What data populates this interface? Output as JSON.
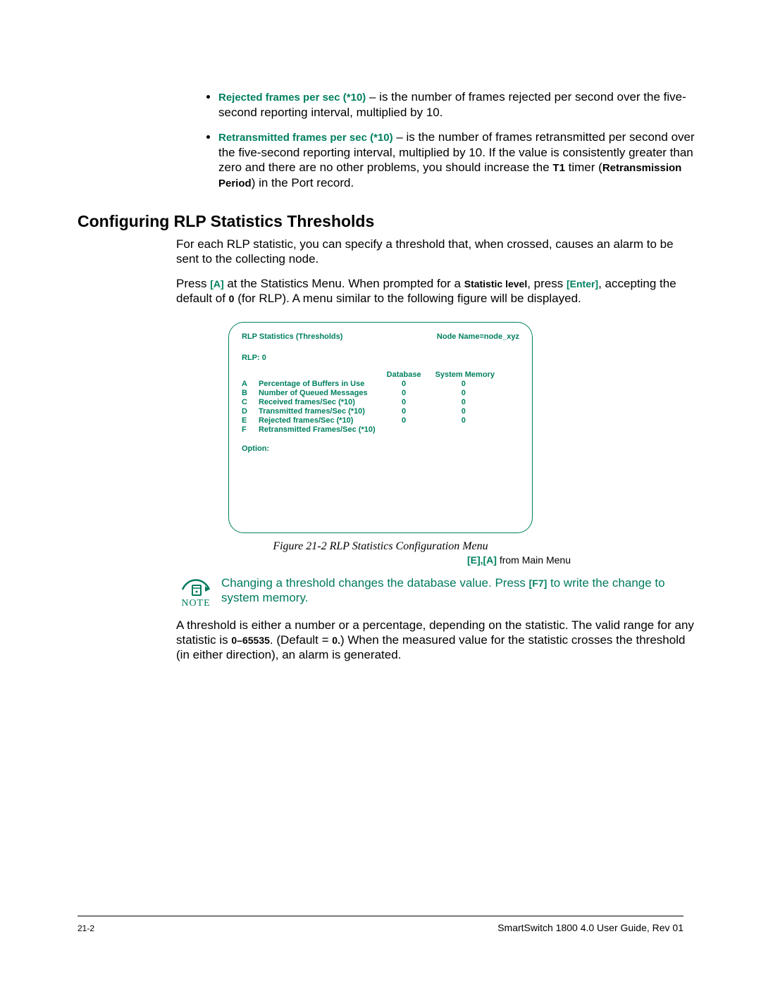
{
  "bullets": {
    "b1_term": "Rejected frames per sec (*10)",
    "b1_text": " – is the number of frames rejected per second over the five-second reporting interval, multiplied by 10.",
    "b2_term": "Retransmitted frames per sec (*10)",
    "b2_text_a": " – is the number of frames retransmitted per second over the five-second reporting interval, multiplied by 10. If the value is consistently greater than zero and there are no other problems, you should increase the ",
    "b2_t1": "T1",
    "b2_text_b": " timer (",
    "b2_retrans": "Retransmission Period",
    "b2_text_c": ") in the Port record."
  },
  "heading": "Configuring RLP Statistics Thresholds",
  "para1": "For each RLP statistic, you can specify a threshold that, when crossed, causes an alarm to be sent to the collecting node.",
  "para2": {
    "a": "Press ",
    "key_a": "[A]",
    "b": " at the Statistics Menu. When prompted for a ",
    "stat_lvl": "Statistic level",
    "c": ", press ",
    "key_enter": "[Enter]",
    "d": ", accepting the default of ",
    "zero": "0",
    "e": " (for RLP). A menu similar to the following figure will be displayed."
  },
  "figure": {
    "title": "RLP Statistics (Thresholds)",
    "node_name": "Node Name=node_xyz",
    "rlp": "RLP: 0",
    "col_db": "Database",
    "col_sys": "System Memory",
    "rows": [
      {
        "k": "A",
        "label": "Percentage of Buffers in Use",
        "db": "0",
        "sys": "0"
      },
      {
        "k": "B",
        "label": "Number of Queued Messages",
        "db": "0",
        "sys": "0"
      },
      {
        "k": "C",
        "label": "Received frames/Sec (*10)",
        "db": "0",
        "sys": "0"
      },
      {
        "k": "D",
        "label": "Transmitted frames/Sec (*10)",
        "db": "0",
        "sys": "0"
      },
      {
        "k": "E",
        "label": "Rejected frames/Sec (*10)",
        "db": "0",
        "sys": "0"
      },
      {
        "k": "F",
        "label": "Retransmitted Frames/Sec (*10)",
        "db": "",
        "sys": ""
      }
    ],
    "option": "Option:"
  },
  "caption": "Figure 21-2   RLP Statistics Configuration Menu",
  "subcap_keys": "[E],[A]",
  "subcap_text": " from Main Menu",
  "note": {
    "label": "NOTE",
    "a": "Changing a threshold changes the database value. Press ",
    "key": "[F7]",
    "b": " to write the change to system memory."
  },
  "para3": {
    "a": "A threshold is either a number or a percentage, depending on the statistic. The valid range for any statistic is ",
    "range": "0–65535",
    "b": ". (Default = ",
    "def": "0.",
    "c": ") When the measured value for the statistic crosses the threshold (in either direction), an alarm is generated."
  },
  "footer": {
    "left": "21-2",
    "right": "SmartSwitch 1800 4.0 User Guide, Rev 01"
  }
}
